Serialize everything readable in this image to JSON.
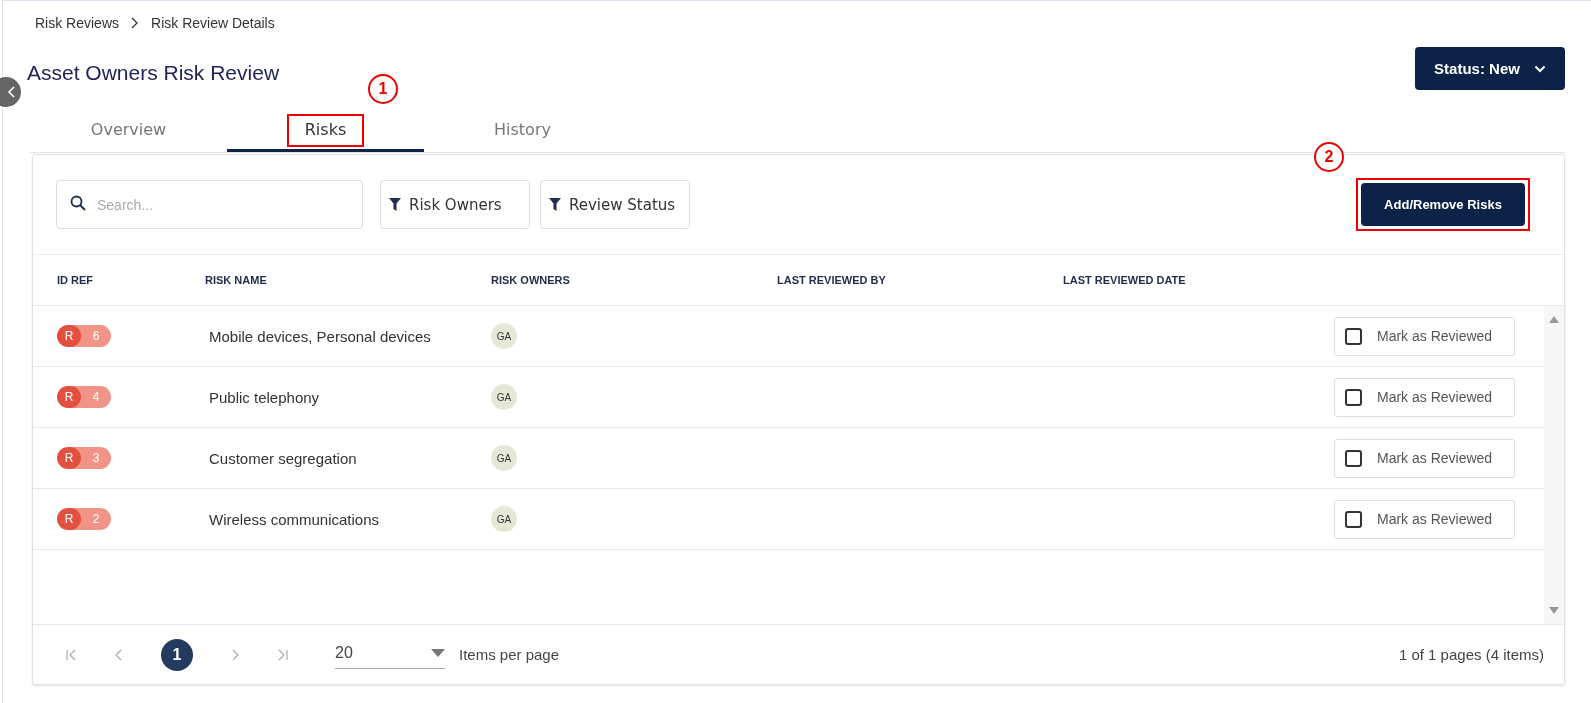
{
  "breadcrumb": [
    {
      "label": "Risk Reviews"
    },
    {
      "label": "Risk Review Details"
    }
  ],
  "title": "Asset Owners Risk Review",
  "status_button": {
    "label": "Status: New"
  },
  "tabs": [
    {
      "label": "Overview",
      "selected": false
    },
    {
      "label": "Risks",
      "selected": true,
      "callout": "1"
    },
    {
      "label": "History",
      "selected": false
    }
  ],
  "search": {
    "placeholder": "Search..."
  },
  "filters": [
    {
      "label": "Risk Owners"
    },
    {
      "label": "Review Status"
    }
  ],
  "add_button": {
    "label": "Add/Remove Risks",
    "callout": "2"
  },
  "table": {
    "columns": [
      "ID REF",
      "RISK NAME",
      "RISK OWNERS",
      "LAST REVIEWED BY",
      "LAST REVIEWED DATE"
    ],
    "rows": [
      {
        "prefix": "R",
        "id": "6",
        "name": "Mobile devices, Personal devices",
        "owner": "GA",
        "action": "Mark as Reviewed",
        "checked": false
      },
      {
        "prefix": "R",
        "id": "4",
        "name": "Public telephony",
        "owner": "GA",
        "action": "Mark as Reviewed",
        "checked": false
      },
      {
        "prefix": "R",
        "id": "3",
        "name": "Customer segregation",
        "owner": "GA",
        "action": "Mark as Reviewed",
        "checked": false
      },
      {
        "prefix": "R",
        "id": "2",
        "name": "Wireless communications",
        "owner": "GA",
        "action": "Mark as Reviewed",
        "checked": false
      }
    ]
  },
  "pager": {
    "pages": [
      {
        "label": "1",
        "selected": true
      }
    ],
    "page_size": "20",
    "page_size_label": "Items per page",
    "summary": "1 of 1 pages (4 items)"
  }
}
